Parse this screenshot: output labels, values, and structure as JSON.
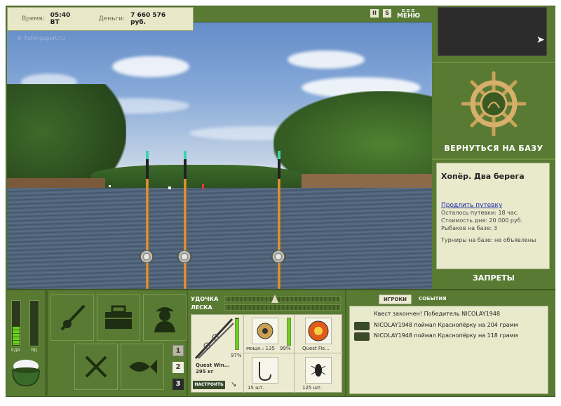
{
  "status": {
    "time_label": "Время:",
    "time_value": "05:40 ВТ",
    "money_label": "Деньги:",
    "money_value": "7 660 576 руб."
  },
  "topbar": {
    "pause_btn": "II",
    "sound_btn": "S",
    "menu_label": "МЕНЮ",
    "menu_icon": "≡≡≡"
  },
  "scene": {
    "watermark": "© fishingsport.ru"
  },
  "right_panel": {
    "back_to_base": "ВЕРНУТЬСЯ НА БАЗУ",
    "location_title": "Хопёр. Два берега",
    "extend_link": "Продлить путевку",
    "lines": [
      "Осталось путевки: 18 час.",
      "Стоимость дня: 20 000 руб.",
      "Рыбаков на базе: 3",
      "Турниры на базе: не объявлены"
    ],
    "bans": "ЗАПРЕТЫ"
  },
  "meters": {
    "food_label": "ЕДА",
    "poison_label": "ЯД",
    "food_level": 0.4,
    "poison_level": 0.0
  },
  "pages": [
    "1",
    "2",
    "3"
  ],
  "tackle": {
    "rod_label": "УДОЧКА",
    "line_label": "ЛЕСКА",
    "rod_name": "Quest Win...",
    "rod_weight": "295 кг",
    "rod_durability": "97%",
    "reel_power": "мощн.: 135",
    "reel_durability": "99%",
    "line_name": "Quest Fis...",
    "hooks_count": "15 шт.",
    "bait_count": "125 шт.",
    "setup_button": "НАСТРОИТЬ",
    "rod_bar_level": 0.97,
    "reel_bar_level": 0.99
  },
  "chat": {
    "tab_players": "ИГРОКИ",
    "tab_events": "СОБЫТИЯ",
    "messages": [
      "Квест закончен! Победитель NICOLAY1948",
      "NICOLAY1948 поймал Краснопёрку на 204 грамм",
      "NICOLAY1948 поймал Краснопёрку на 118 грамм"
    ]
  },
  "colors": {
    "panel_green": "#587a32",
    "card_bg": "#e9e9cc",
    "accent_link": "#1a2aa8"
  }
}
